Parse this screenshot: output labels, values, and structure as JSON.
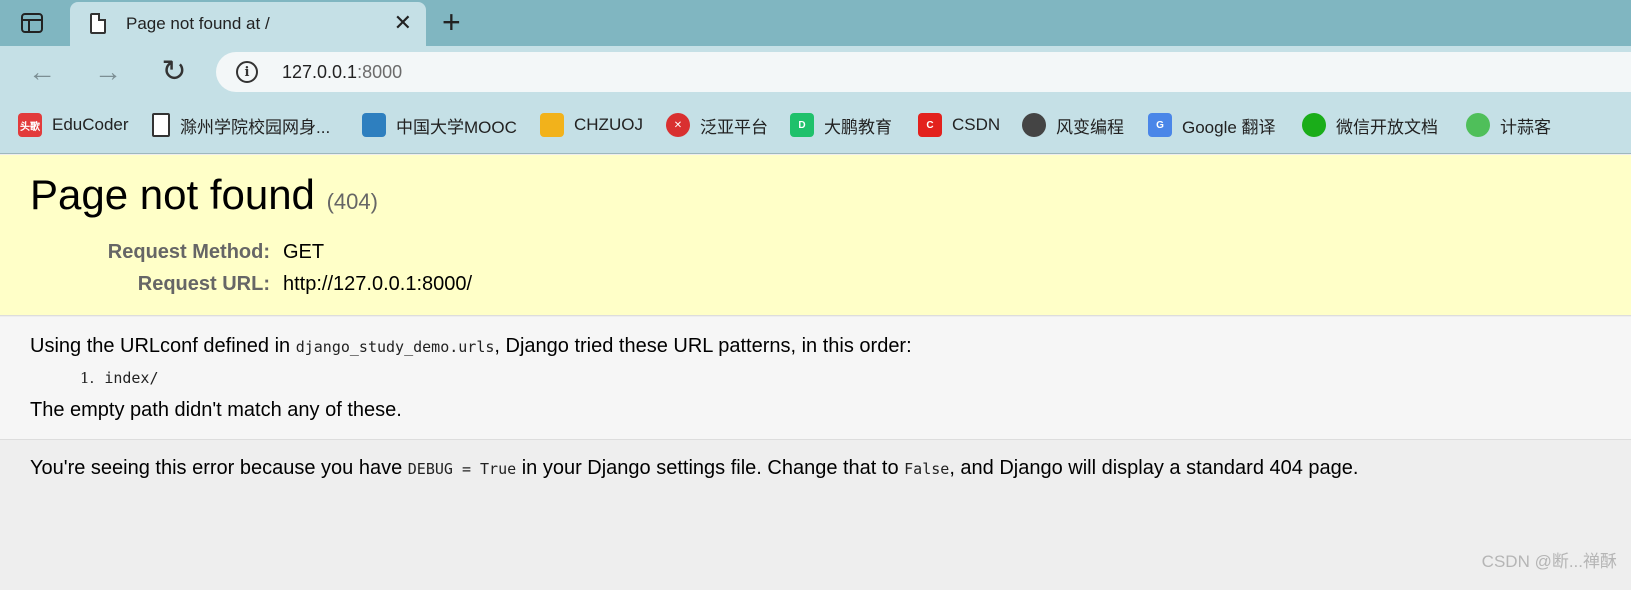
{
  "browser": {
    "tab": {
      "title": "Page not found at /",
      "close_glyph": "✕"
    },
    "new_tab_glyph": "+",
    "toolbar": {
      "back_glyph": "←",
      "forward_glyph": "→",
      "reload_glyph": "↻",
      "info_glyph": "i",
      "url_host": "127.0.0.1",
      "url_port": ":8000"
    },
    "bookmarks": [
      {
        "label": "EduCoder",
        "icon": "toutiao-icon",
        "icon_text": "头歌",
        "color": "#e23b3b"
      },
      {
        "label": "滁州学院校园网身...",
        "icon": "page-icon",
        "icon_text": "",
        "color": "#ffffff"
      },
      {
        "label": "中国大学MOOC",
        "icon": "mooc-icon",
        "icon_text": "",
        "color": "#2e7fbf"
      },
      {
        "label": "CHZUOJ",
        "icon": "chzuoj-icon",
        "icon_text": "",
        "color": "#f2b21b"
      },
      {
        "label": "泛亚平台",
        "icon": "fanya-icon",
        "icon_text": "✕",
        "color": "#d93030"
      },
      {
        "label": "大鹏教育",
        "icon": "dapeng-icon",
        "icon_text": "D",
        "color": "#1fc16b"
      },
      {
        "label": "CSDN",
        "icon": "csdn-icon",
        "icon_text": "C",
        "color": "#e3211d"
      },
      {
        "label": "风变编程",
        "icon": "panda-icon",
        "icon_text": "",
        "color": "#444444"
      },
      {
        "label": "Google 翻译",
        "icon": "google-translate-icon",
        "icon_text": "G",
        "color": "#4a86e8"
      },
      {
        "label": "微信开放文档",
        "icon": "wechat-icon",
        "icon_text": "",
        "color": "#1aad19"
      },
      {
        "label": "计蒜客",
        "icon": "jisuanke-icon",
        "icon_text": "",
        "color": "#4fbf5a"
      }
    ]
  },
  "page": {
    "title": "Page not found",
    "code": "(404)",
    "request_method_label": "Request Method:",
    "request_method": "GET",
    "request_url_label": "Request URL:",
    "request_url": "http://127.0.0.1:8000/",
    "urlconf_pre": "Using the URLconf defined in ",
    "urlconf_module": "django_study_demo.urls",
    "urlconf_post": ", Django tried these URL patterns, in this order:",
    "patterns": [
      {
        "num": "1.",
        "pattern": "index/"
      }
    ],
    "empty_path_msg": "The empty path didn't match any of these.",
    "debug_pre": "You're seeing this error because you have ",
    "debug_code": "DEBUG = True",
    "debug_mid": " in your Django settings file. Change that to ",
    "debug_false": "False",
    "debug_post": ", and Django will display a standard 404 page."
  },
  "watermark": "CSDN @断...禅酥"
}
